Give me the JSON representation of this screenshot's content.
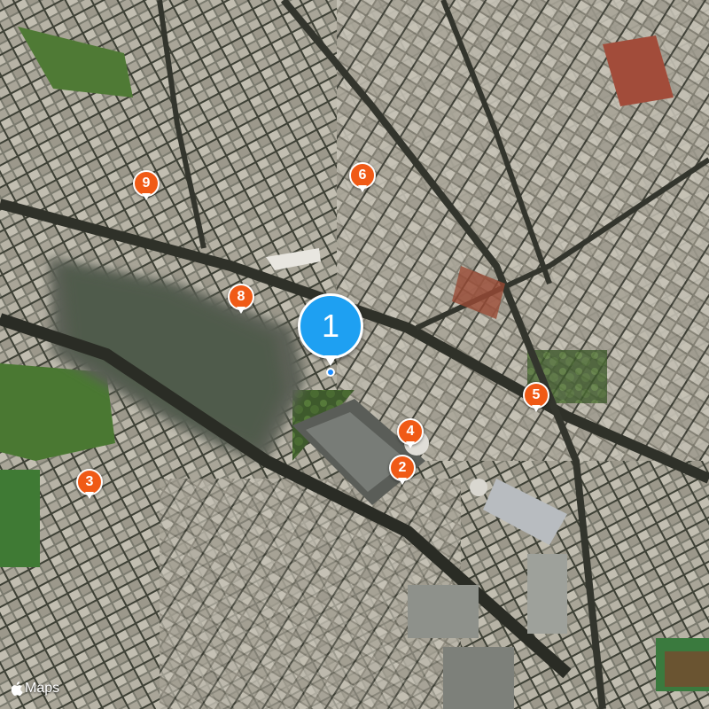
{
  "map": {
    "type": "satellite",
    "attribution_logo": "apple-logo",
    "attribution_label": "Maps"
  },
  "markers": [
    {
      "label": "1",
      "style": "primary",
      "color": "#1ea0f2"
    },
    {
      "label": "2",
      "style": "secondary",
      "color": "#f05a16"
    },
    {
      "label": "3",
      "style": "secondary",
      "color": "#f05a16"
    },
    {
      "label": "4",
      "style": "secondary",
      "color": "#f05a16"
    },
    {
      "label": "5",
      "style": "secondary",
      "color": "#f05a16"
    },
    {
      "label": "6",
      "style": "secondary",
      "color": "#f05a16"
    },
    {
      "label": "8",
      "style": "secondary",
      "color": "#f05a16"
    },
    {
      "label": "9",
      "style": "secondary",
      "color": "#f05a16"
    }
  ]
}
